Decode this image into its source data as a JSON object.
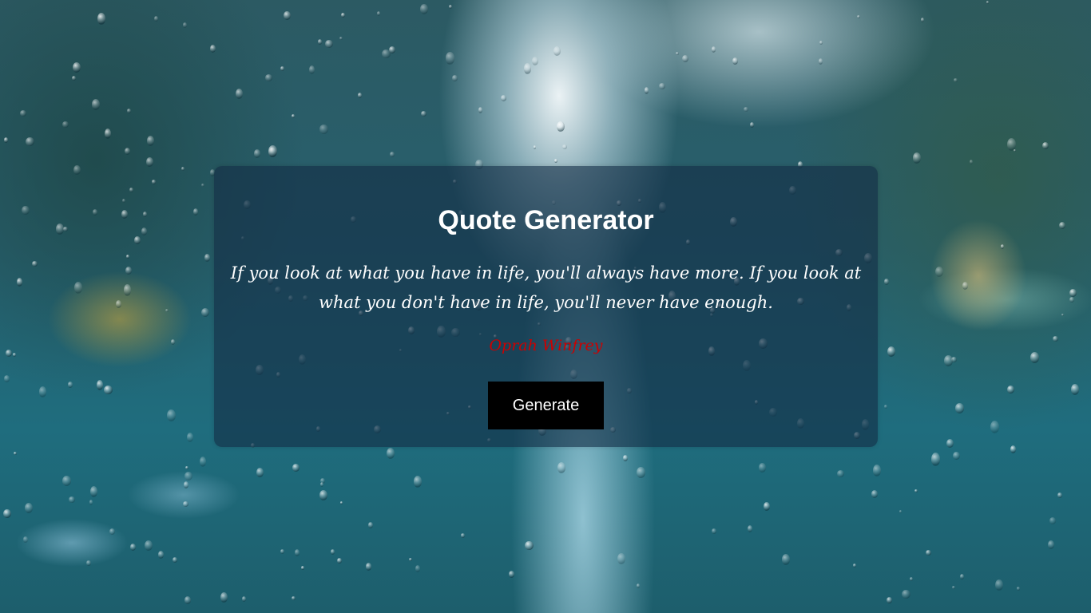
{
  "app": {
    "title": "Quote Generator"
  },
  "quote": {
    "text": "If you look at what you have in life, you'll always have more. If you look at what you don't have in life, you'll never have enough.",
    "author": "Oprah Winfrey"
  },
  "actions": {
    "generate_label": "Generate"
  },
  "colors": {
    "author": "#cc0000",
    "button_bg": "#000000",
    "button_text": "#ffffff",
    "card_bg": "#142d46"
  }
}
